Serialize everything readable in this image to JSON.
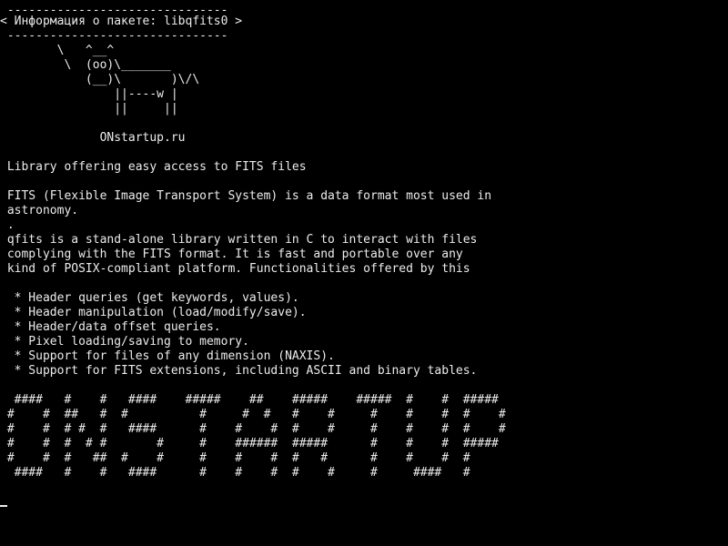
{
  "console": {
    "lines": [
      " -------------------------------",
      "< Информация о пакете: libqfits0 >",
      " -------------------------------",
      "        \\   ^__^",
      "         \\  (oo)\\_______",
      "            (__)\\       )\\/\\",
      "                ||----w |",
      "                ||     ||",
      "",
      "              ONstartup.ru",
      "",
      " Library offering easy access to FITS files",
      "",
      " FITS (Flexible Image Transport System) is a data format most used in",
      " astronomy.",
      " .",
      " qfits is a stand-alone library written in C to interact with files",
      " complying with the FITS format. It is fast and portable over any",
      " kind of POSIX-compliant platform. Functionalities offered by this",
      "",
      "  * Header queries (get keywords, values).",
      "  * Header manipulation (load/modify/save).",
      "  * Header/data offset queries.",
      "  * Pixel loading/saving to memory.",
      "  * Support for files of any dimension (NAXIS).",
      "  * Support for FITS extensions, including ASCII and binary tables.",
      "",
      "  ####   #    #   ####    #####    ##    #####    #####  #    #  #####",
      " #    #  ##   #  #          #     #  #   #    #     #    #    #  #    #",
      " #    #  # #  #   ####      #    #    #  #    #     #    #    #  #    #",
      " #    #  #  # #       #     #    ######  #####      #    #    #  #####",
      " #    #  #   ##  #    #     #    #    #  #   #      #    #    #  #",
      "  ####   #    #   ####      #    #    #  #    #     #     ####   #"
    ]
  }
}
